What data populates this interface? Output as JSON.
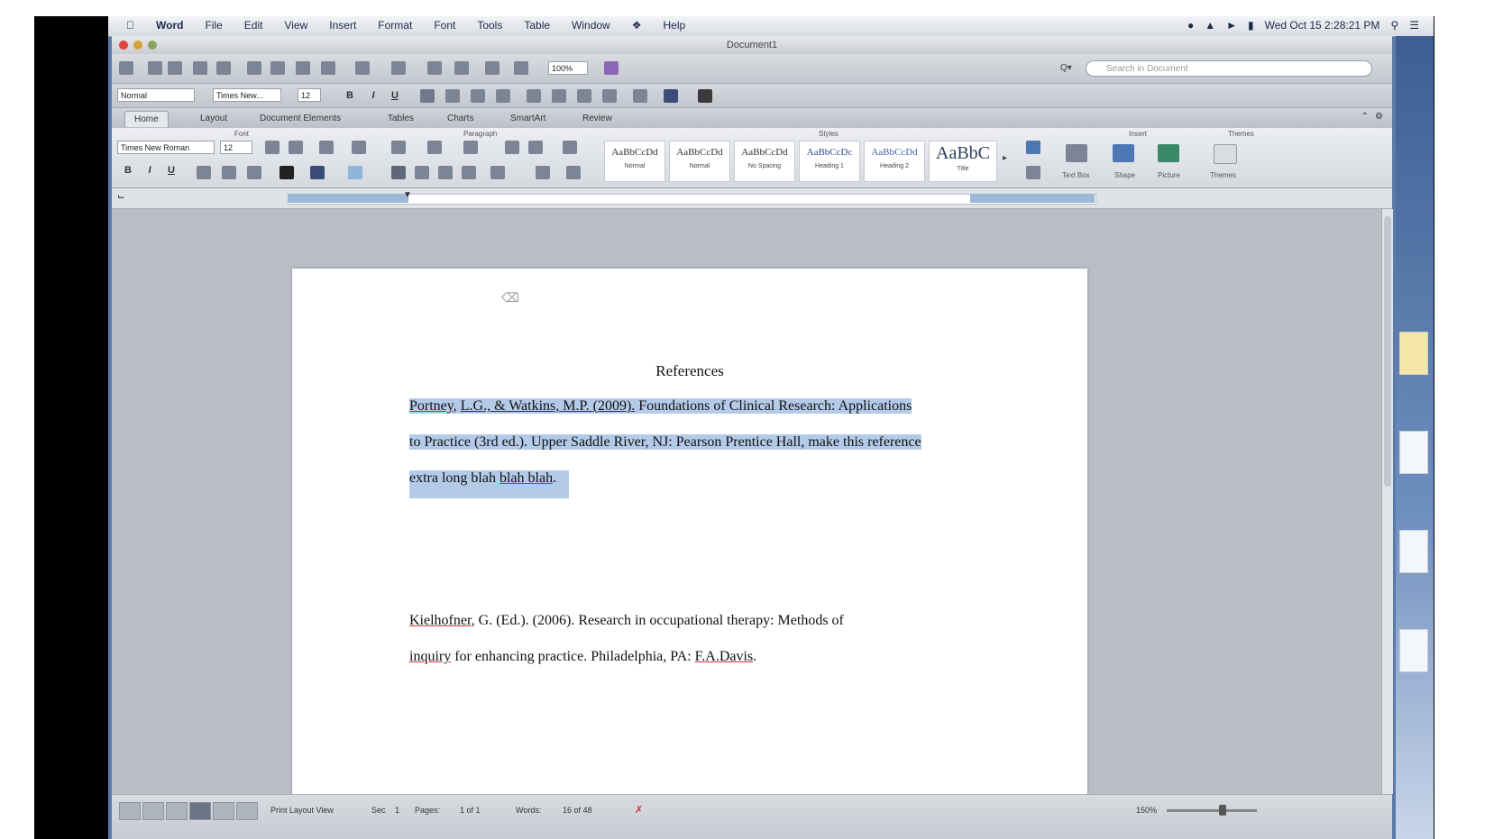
{
  "menubar": {
    "apple": "",
    "items": [
      "Word",
      "File",
      "Edit",
      "View",
      "Insert",
      "Format",
      "Font",
      "Tools",
      "Table",
      "Window",
      "Help"
    ],
    "clock": "Wed Oct 15  2:28:21 PM"
  },
  "window": {
    "title": "Document1"
  },
  "toolbar": {
    "zoom": "100%",
    "search_placeholder": "Search in Document"
  },
  "format_bar": {
    "style": "Normal",
    "font": "Times New...",
    "size": "12"
  },
  "ribbon_tabs": [
    "Home",
    "Layout",
    "Document Elements",
    "Tables",
    "Charts",
    "SmartArt",
    "Review"
  ],
  "ribbon": {
    "groups": [
      "Font",
      "Paragraph",
      "Styles",
      "Insert",
      "Themes"
    ],
    "font_name": "Times New Roman",
    "font_size": "12",
    "styles": [
      {
        "sample": "AaBbCcDd",
        "name": "Normal"
      },
      {
        "sample": "AaBbCcDd",
        "name": "Normal"
      },
      {
        "sample": "AaBbCcDd",
        "name": "No Spacing"
      },
      {
        "sample": "AaBbCcDc",
        "name": "Heading 1"
      },
      {
        "sample": "AaBbCcDd",
        "name": "Heading 2"
      },
      {
        "sample": "AaBbC",
        "name": "Title"
      }
    ],
    "insert_items": [
      "Text Box",
      "Shape",
      "Picture"
    ],
    "themes_label": "Themes"
  },
  "document": {
    "heading": "References",
    "ref1": {
      "line1_u1": "Portney",
      "line1_sep": ", ",
      "line1_u2": "L.G., & Watkins, M.P. (2009).",
      "line1_rest": " Foundations of Clinical Research: Applications",
      "line2": "to Practice (3rd ed.). Upper Saddle River, NJ: Pearson Prentice Hall, make this reference",
      "line3_a": "extra long blah ",
      "line3_u": "blah blah",
      "line3_end": "."
    },
    "ref2": {
      "line1_u": "Kielhofner",
      "line1_rest": ", G. (Ed.). (2006). Research in occupational therapy: Methods of",
      "line2_u": "inquiry",
      "line2_rest": " for enhancing practice. Philadelphia, PA: ",
      "line2_u2": "F.A.Davis",
      "line2_end": "."
    }
  },
  "statusbar": {
    "view": "Print Layout View",
    "sec": "Sec",
    "sec_val": "1",
    "pages": "Pages:",
    "pages_val": "1 of 1",
    "words": "Words:",
    "words_val": "16 of 48",
    "zoom": "150%"
  }
}
